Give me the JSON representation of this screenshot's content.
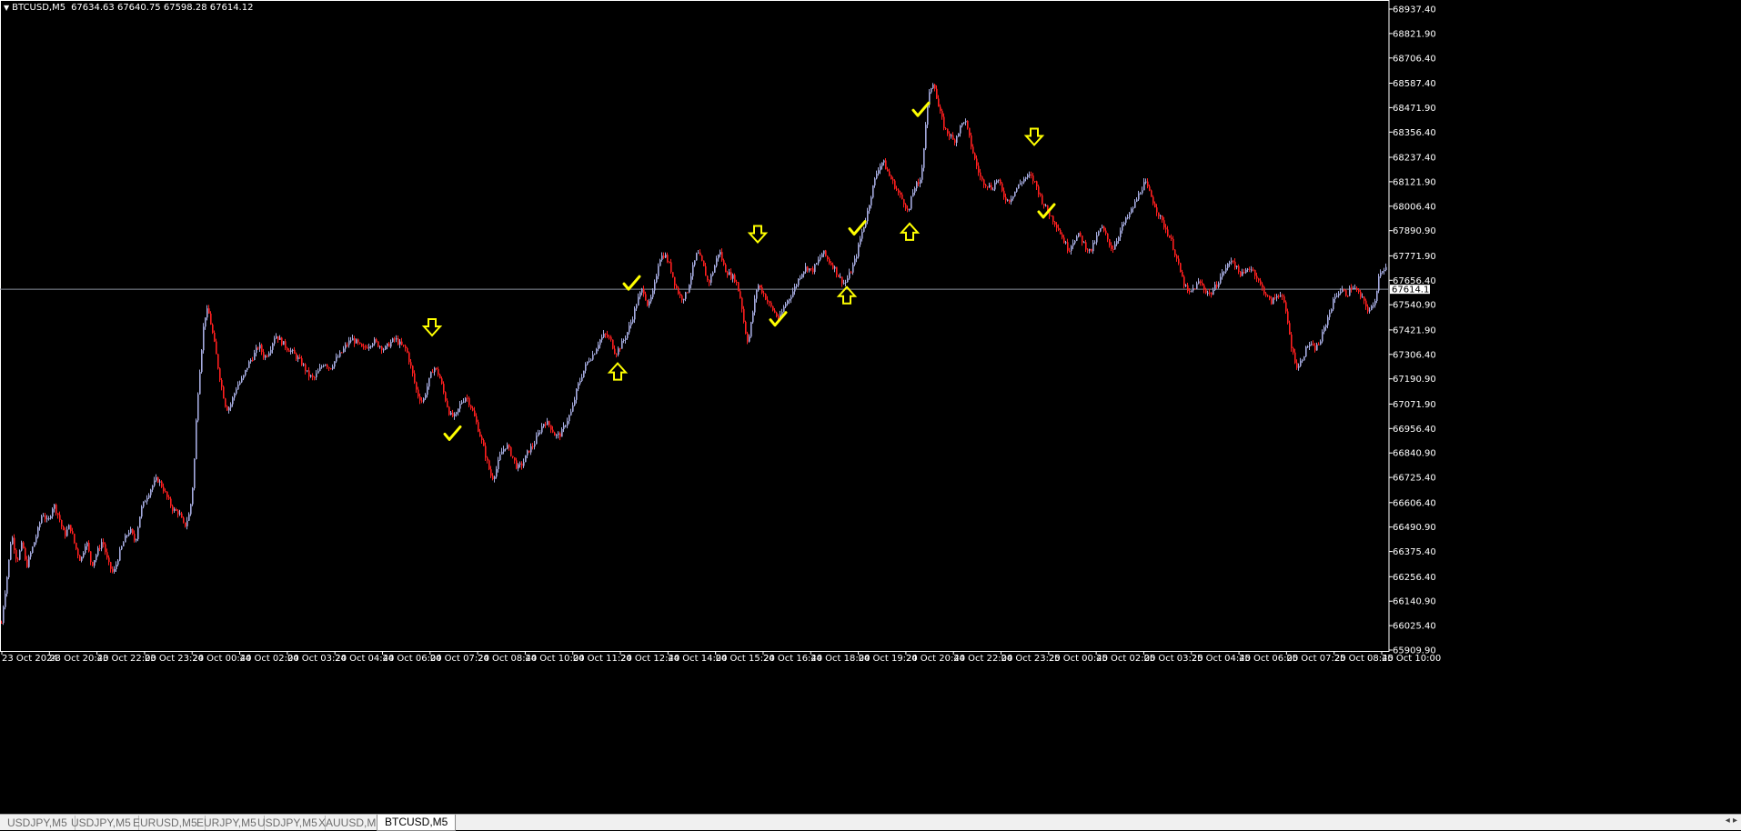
{
  "header": {
    "symbol": "BTCUSD,M5",
    "ohlc": "67634.63 67640.75 67598.28 67614.12"
  },
  "chart_data": {
    "type": "candlestick",
    "symbol": "BTCUSD",
    "timeframe": "M5",
    "current_price": "67614.12",
    "y_ticks": [
      "68937.40",
      "68821.90",
      "68706.40",
      "68587.40",
      "68471.90",
      "68356.40",
      "68237.40",
      "68121.90",
      "68006.40",
      "67890.90",
      "67771.90",
      "67656.40",
      "67540.90",
      "67421.90",
      "67306.40",
      "67190.90",
      "67071.90",
      "66956.40",
      "66840.90",
      "66725.40",
      "66606.40",
      "66490.90",
      "66375.40",
      "66256.40",
      "66140.90",
      "66025.40",
      "65909.90"
    ],
    "x_ticks": [
      "23 Oct 2024",
      "23 Oct 20:40",
      "23 Oct 22:00",
      "23 Oct 23:20",
      "24 Oct 00:40",
      "24 Oct 02:00",
      "24 Oct 03:20",
      "24 Oct 04:40",
      "24 Oct 06:00",
      "24 Oct 07:20",
      "24 Oct 08:40",
      "24 Oct 10:00",
      "24 Oct 11:20",
      "24 Oct 12:40",
      "24 Oct 14:00",
      "24 Oct 15:20",
      "24 Oct 16:40",
      "24 Oct 18:00",
      "24 Oct 19:20",
      "24 Oct 20:40",
      "24 Oct 22:00",
      "24 Oct 23:20",
      "25 Oct 00:40",
      "25 Oct 02:00",
      "25 Oct 03:20",
      "25 Oct 04:40",
      "25 Oct 06:00",
      "25 Oct 07:20",
      "25 Oct 08:40",
      "25 Oct 10:00"
    ],
    "ylim": [
      65909.9,
      68937.4
    ],
    "path_points": [
      [
        0,
        65998
      ],
      [
        3,
        66120
      ],
      [
        8,
        66290
      ],
      [
        12,
        66460
      ],
      [
        18,
        66330
      ],
      [
        24,
        66420
      ],
      [
        28,
        66300
      ],
      [
        34,
        66380
      ],
      [
        40,
        66460
      ],
      [
        46,
        66560
      ],
      [
        52,
        66510
      ],
      [
        58,
        66600
      ],
      [
        64,
        66540
      ],
      [
        70,
        66450
      ],
      [
        76,
        66500
      ],
      [
        82,
        66400
      ],
      [
        88,
        66330
      ],
      [
        94,
        66430
      ],
      [
        100,
        66310
      ],
      [
        106,
        66370
      ],
      [
        112,
        66430
      ],
      [
        118,
        66320
      ],
      [
        124,
        66270
      ],
      [
        130,
        66360
      ],
      [
        136,
        66430
      ],
      [
        142,
        66480
      ],
      [
        148,
        66420
      ],
      [
        154,
        66570
      ],
      [
        160,
        66630
      ],
      [
        166,
        66680
      ],
      [
        172,
        66720
      ],
      [
        178,
        66680
      ],
      [
        184,
        66620
      ],
      [
        190,
        66570
      ],
      [
        196,
        66560
      ],
      [
        202,
        66490
      ],
      [
        208,
        66560
      ],
      [
        212,
        66720
      ],
      [
        216,
        67080
      ],
      [
        220,
        67290
      ],
      [
        224,
        67480
      ],
      [
        228,
        67520
      ],
      [
        232,
        67430
      ],
      [
        236,
        67330
      ],
      [
        240,
        67220
      ],
      [
        244,
        67130
      ],
      [
        248,
        67050
      ],
      [
        252,
        67060
      ],
      [
        256,
        67110
      ],
      [
        260,
        67160
      ],
      [
        266,
        67190
      ],
      [
        272,
        67260
      ],
      [
        278,
        67300
      ],
      [
        284,
        67350
      ],
      [
        290,
        67290
      ],
      [
        296,
        67330
      ],
      [
        302,
        67400
      ],
      [
        308,
        67370
      ],
      [
        314,
        67340
      ],
      [
        320,
        67320
      ],
      [
        326,
        67290
      ],
      [
        332,
        67260
      ],
      [
        338,
        67210
      ],
      [
        344,
        67190
      ],
      [
        350,
        67230
      ],
      [
        356,
        67270
      ],
      [
        362,
        67240
      ],
      [
        368,
        67280
      ],
      [
        374,
        67310
      ],
      [
        380,
        67350
      ],
      [
        386,
        67380
      ],
      [
        392,
        67360
      ],
      [
        398,
        67330
      ],
      [
        404,
        67350
      ],
      [
        410,
        67370
      ],
      [
        416,
        67350
      ],
      [
        422,
        67330
      ],
      [
        428,
        67360
      ],
      [
        434,
        67380
      ],
      [
        440,
        67350
      ],
      [
        446,
        67330
      ],
      [
        452,
        67230
      ],
      [
        458,
        67120
      ],
      [
        464,
        67080
      ],
      [
        470,
        67170
      ],
      [
        476,
        67250
      ],
      [
        482,
        67210
      ],
      [
        488,
        67110
      ],
      [
        494,
        67020
      ],
      [
        500,
        67010
      ],
      [
        506,
        67080
      ],
      [
        512,
        67110
      ],
      [
        518,
        67050
      ],
      [
        524,
        66970
      ],
      [
        530,
        66880
      ],
      [
        536,
        66780
      ],
      [
        540,
        66720
      ],
      [
        544,
        66750
      ],
      [
        550,
        66840
      ],
      [
        556,
        66880
      ],
      [
        562,
        66830
      ],
      [
        568,
        66770
      ],
      [
        574,
        66790
      ],
      [
        580,
        66850
      ],
      [
        586,
        66880
      ],
      [
        592,
        66940
      ],
      [
        598,
        66990
      ],
      [
        604,
        66970
      ],
      [
        610,
        66920
      ],
      [
        616,
        66930
      ],
      [
        622,
        66990
      ],
      [
        628,
        67040
      ],
      [
        634,
        67150
      ],
      [
        640,
        67220
      ],
      [
        646,
        67280
      ],
      [
        652,
        67310
      ],
      [
        658,
        67370
      ],
      [
        664,
        67400
      ],
      [
        670,
        67380
      ],
      [
        676,
        67310
      ],
      [
        682,
        67350
      ],
      [
        688,
        67400
      ],
      [
        694,
        67470
      ],
      [
        700,
        67560
      ],
      [
        706,
        67620
      ],
      [
        712,
        67530
      ],
      [
        718,
        67610
      ],
      [
        724,
        67760
      ],
      [
        730,
        67780
      ],
      [
        736,
        67720
      ],
      [
        742,
        67630
      ],
      [
        748,
        67570
      ],
      [
        754,
        67590
      ],
      [
        760,
        67700
      ],
      [
        766,
        67790
      ],
      [
        772,
        67730
      ],
      [
        778,
        67640
      ],
      [
        784,
        67710
      ],
      [
        790,
        67800
      ],
      [
        796,
        67710
      ],
      [
        802,
        67680
      ],
      [
        808,
        67660
      ],
      [
        814,
        67560
      ],
      [
        818,
        67430
      ],
      [
        822,
        67360
      ],
      [
        826,
        67480
      ],
      [
        832,
        67640
      ],
      [
        838,
        67600
      ],
      [
        844,
        67550
      ],
      [
        850,
        67510
      ],
      [
        856,
        67470
      ],
      [
        862,
        67540
      ],
      [
        868,
        67580
      ],
      [
        874,
        67630
      ],
      [
        880,
        67690
      ],
      [
        886,
        67720
      ],
      [
        892,
        67700
      ],
      [
        898,
        67740
      ],
      [
        904,
        67790
      ],
      [
        910,
        67750
      ],
      [
        916,
        67720
      ],
      [
        922,
        67670
      ],
      [
        928,
        67640
      ],
      [
        934,
        67690
      ],
      [
        940,
        67760
      ],
      [
        946,
        67870
      ],
      [
        952,
        67960
      ],
      [
        958,
        68080
      ],
      [
        964,
        68180
      ],
      [
        970,
        68220
      ],
      [
        976,
        68160
      ],
      [
        982,
        68110
      ],
      [
        988,
        68060
      ],
      [
        994,
        68020
      ],
      [
        998,
        67970
      ],
      [
        1002,
        68060
      ],
      [
        1006,
        68110
      ],
      [
        1010,
        68100
      ],
      [
        1014,
        68230
      ],
      [
        1018,
        68450
      ],
      [
        1022,
        68560
      ],
      [
        1026,
        68600
      ],
      [
        1030,
        68490
      ],
      [
        1034,
        68430
      ],
      [
        1038,
        68370
      ],
      [
        1044,
        68340
      ],
      [
        1048,
        68310
      ],
      [
        1054,
        68370
      ],
      [
        1060,
        68420
      ],
      [
        1066,
        68310
      ],
      [
        1072,
        68210
      ],
      [
        1078,
        68130
      ],
      [
        1084,
        68110
      ],
      [
        1090,
        68090
      ],
      [
        1096,
        68140
      ],
      [
        1102,
        68060
      ],
      [
        1108,
        68030
      ],
      [
        1114,
        68070
      ],
      [
        1120,
        68110
      ],
      [
        1126,
        68140
      ],
      [
        1132,
        68150
      ],
      [
        1138,
        68110
      ],
      [
        1144,
        68040
      ],
      [
        1150,
        67990
      ],
      [
        1156,
        67950
      ],
      [
        1162,
        67910
      ],
      [
        1168,
        67850
      ],
      [
        1174,
        67800
      ],
      [
        1180,
        67850
      ],
      [
        1186,
        67870
      ],
      [
        1192,
        67820
      ],
      [
        1198,
        67790
      ],
      [
        1204,
        67850
      ],
      [
        1210,
        67910
      ],
      [
        1216,
        67860
      ],
      [
        1222,
        67800
      ],
      [
        1228,
        67860
      ],
      [
        1234,
        67920
      ],
      [
        1240,
        67960
      ],
      [
        1246,
        68010
      ],
      [
        1252,
        68070
      ],
      [
        1258,
        68120
      ],
      [
        1264,
        68060
      ],
      [
        1270,
        68000
      ],
      [
        1276,
        67940
      ],
      [
        1282,
        67890
      ],
      [
        1288,
        67830
      ],
      [
        1294,
        67740
      ],
      [
        1300,
        67650
      ],
      [
        1306,
        67590
      ],
      [
        1312,
        67620
      ],
      [
        1318,
        67650
      ],
      [
        1324,
        67610
      ],
      [
        1330,
        67590
      ],
      [
        1336,
        67630
      ],
      [
        1342,
        67680
      ],
      [
        1348,
        67720
      ],
      [
        1354,
        67760
      ],
      [
        1360,
        67700
      ],
      [
        1366,
        67680
      ],
      [
        1372,
        67720
      ],
      [
        1378,
        67700
      ],
      [
        1384,
        67640
      ],
      [
        1390,
        67600
      ],
      [
        1396,
        67550
      ],
      [
        1402,
        67580
      ],
      [
        1408,
        67600
      ],
      [
        1414,
        67480
      ],
      [
        1420,
        67320
      ],
      [
        1426,
        67240
      ],
      [
        1432,
        67300
      ],
      [
        1438,
        67360
      ],
      [
        1444,
        67330
      ],
      [
        1450,
        67360
      ],
      [
        1456,
        67440
      ],
      [
        1462,
        67520
      ],
      [
        1468,
        67590
      ],
      [
        1474,
        67610
      ],
      [
        1480,
        67590
      ],
      [
        1486,
        67630
      ],
      [
        1492,
        67600
      ],
      [
        1498,
        67560
      ],
      [
        1504,
        67510
      ],
      [
        1510,
        67540
      ],
      [
        1516,
        67700
      ],
      [
        1524,
        67720
      ]
    ],
    "annotations": [
      {
        "type": "arrow-down",
        "x": 475,
        "price": 67430
      },
      {
        "type": "check",
        "x": 497,
        "price": 66930
      },
      {
        "type": "arrow-up",
        "x": 679,
        "price": 67230
      },
      {
        "type": "check",
        "x": 694,
        "price": 67640
      },
      {
        "type": "arrow-down",
        "x": 833,
        "price": 67870
      },
      {
        "type": "check",
        "x": 855,
        "price": 67470
      },
      {
        "type": "arrow-up",
        "x": 931,
        "price": 67590
      },
      {
        "type": "check",
        "x": 942,
        "price": 67900
      },
      {
        "type": "arrow-up",
        "x": 1000,
        "price": 67890
      },
      {
        "type": "check",
        "x": 1012,
        "price": 68460
      },
      {
        "type": "arrow-down",
        "x": 1137,
        "price": 68330
      },
      {
        "type": "check",
        "x": 1150,
        "price": 67980
      }
    ],
    "colors": {
      "bull": "#a5abdf",
      "bear": "#ff1f1f",
      "annotation": "#ffff00",
      "price_line": "#8a8f9c",
      "background": "#000000",
      "axis_text": "#ffffff"
    }
  },
  "tabs": [
    {
      "label": "USDJPY,M5",
      "active": false
    },
    {
      "label": "USDJPY,M5",
      "active": false
    },
    {
      "label": "EURUSD,M5",
      "active": false
    },
    {
      "label": "EURJPY,M5",
      "active": false
    },
    {
      "label": "USDJPY,M5",
      "active": false
    },
    {
      "label": "XAUUSD,M5",
      "active": false
    },
    {
      "label": "BTCUSD,M5",
      "active": true
    }
  ],
  "tab_scroll": "◂ ▸"
}
